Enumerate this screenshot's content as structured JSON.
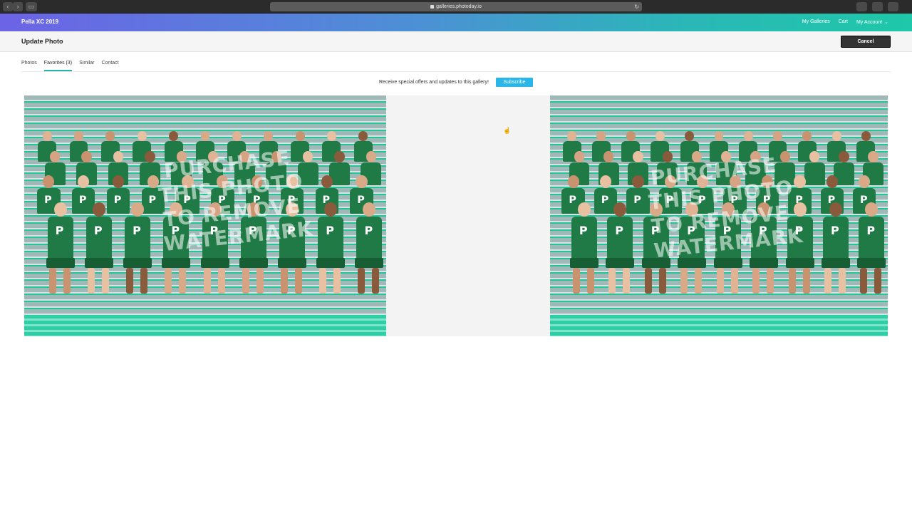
{
  "browser": {
    "url": "galleries.photoday.io"
  },
  "header": {
    "brand": "Pella XC 2019",
    "nav": {
      "my_galleries": "My Galleries",
      "cart": "Cart",
      "my_account": "My Account"
    },
    "gradient_colors": [
      "#6c63e6",
      "#4d8fd6",
      "#2ab7b7",
      "#1ec8a8"
    ]
  },
  "titlebar": {
    "title": "Update Photo",
    "cancel_label": "Cancel"
  },
  "tabs": [
    {
      "label": "Photos",
      "active": false
    },
    {
      "label": "Favorites (3)",
      "active": true
    },
    {
      "label": "Similar",
      "active": false
    },
    {
      "label": "Contact",
      "active": false
    }
  ],
  "subscribe": {
    "text": "Receive special offers and updates to this gallery!",
    "button_label": "Subscribe",
    "button_color": "#29b6e8"
  },
  "photos": {
    "watermark_lines": [
      "PURCHASE",
      "THIS PHOTO",
      "TO REMOVE",
      "WATERMARK"
    ],
    "jersey_letter": "P",
    "jersey_color": "#1f7a45"
  }
}
